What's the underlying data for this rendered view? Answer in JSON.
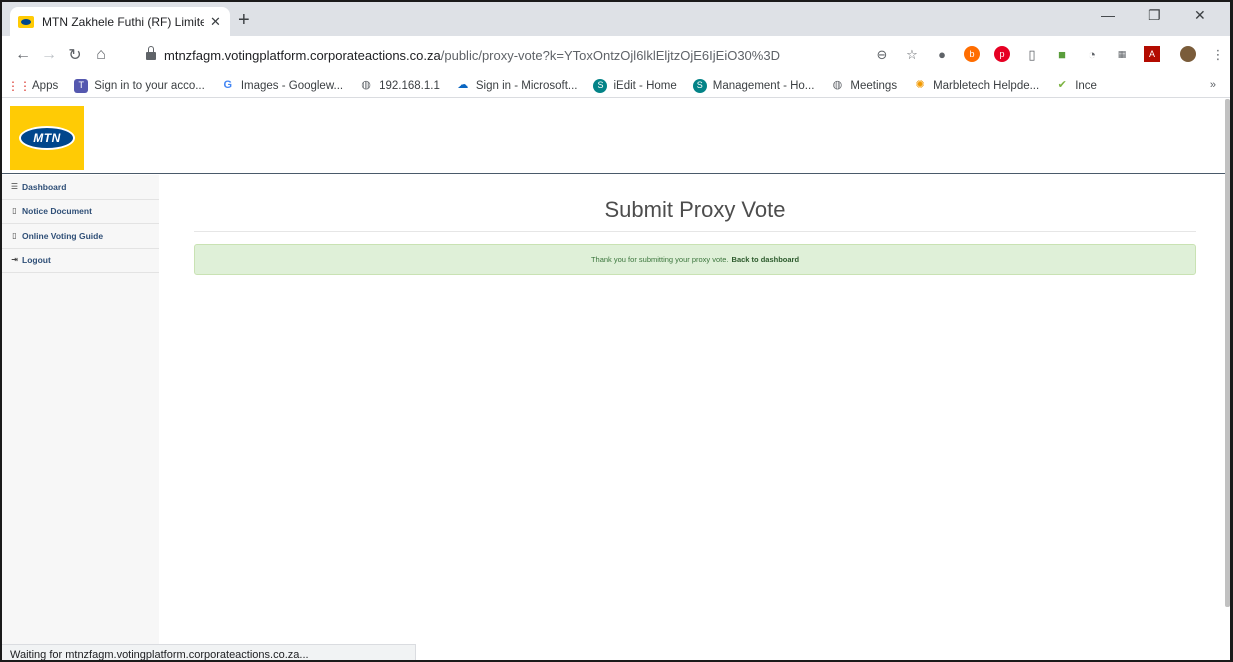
{
  "browser": {
    "tab_title": "MTN Zakhele Futhi (RF) Limited - ",
    "url_host": "mtnzfagm.votingplatform.corporateactions.co.za",
    "url_path": "/public/proxy-vote?k=YToxOntzOjl6lklEljtzOjE6IjEiO30%3D",
    "status_text": "Waiting for mtnzfagm.votingplatform.corporateactions.co.za..."
  },
  "bookmarks": [
    {
      "label": "Apps",
      "icon": "apps-grid-icon"
    },
    {
      "label": "Sign in to your acco...",
      "icon": "teams-icon"
    },
    {
      "label": "Images - Googlew...",
      "icon": "google-icon"
    },
    {
      "label": "192.168.1.1",
      "icon": "globe-icon"
    },
    {
      "label": "Sign in - Microsoft...",
      "icon": "onedrive-icon"
    },
    {
      "label": "iEdit - Home",
      "icon": "sharepoint-icon"
    },
    {
      "label": "Management - Ho...",
      "icon": "sharepoint-icon"
    },
    {
      "label": "Meetings",
      "icon": "globe-icon"
    },
    {
      "label": "Marbletech Helpde...",
      "icon": "helpdesk-icon"
    },
    {
      "label": "Ince",
      "icon": "checkmark-icon"
    }
  ],
  "logo": {
    "text": "MTN"
  },
  "sidebar": {
    "items": [
      {
        "label": "Dashboard",
        "icon": "list-icon"
      },
      {
        "label": "Notice Document",
        "icon": "document-icon"
      },
      {
        "label": "Online Voting Guide",
        "icon": "document-icon"
      },
      {
        "label": "Logout",
        "icon": "logout-icon"
      }
    ]
  },
  "main": {
    "heading": "Submit Proxy Vote",
    "alert_text": "Thank you for submitting your proxy vote.",
    "alert_link": "Back to dashboard"
  },
  "colors": {
    "brand_yellow": "#ffcb05",
    "brand_blue": "#00468c",
    "alert_bg": "#dff0d8",
    "sidebar_link": "#2f4f77"
  }
}
